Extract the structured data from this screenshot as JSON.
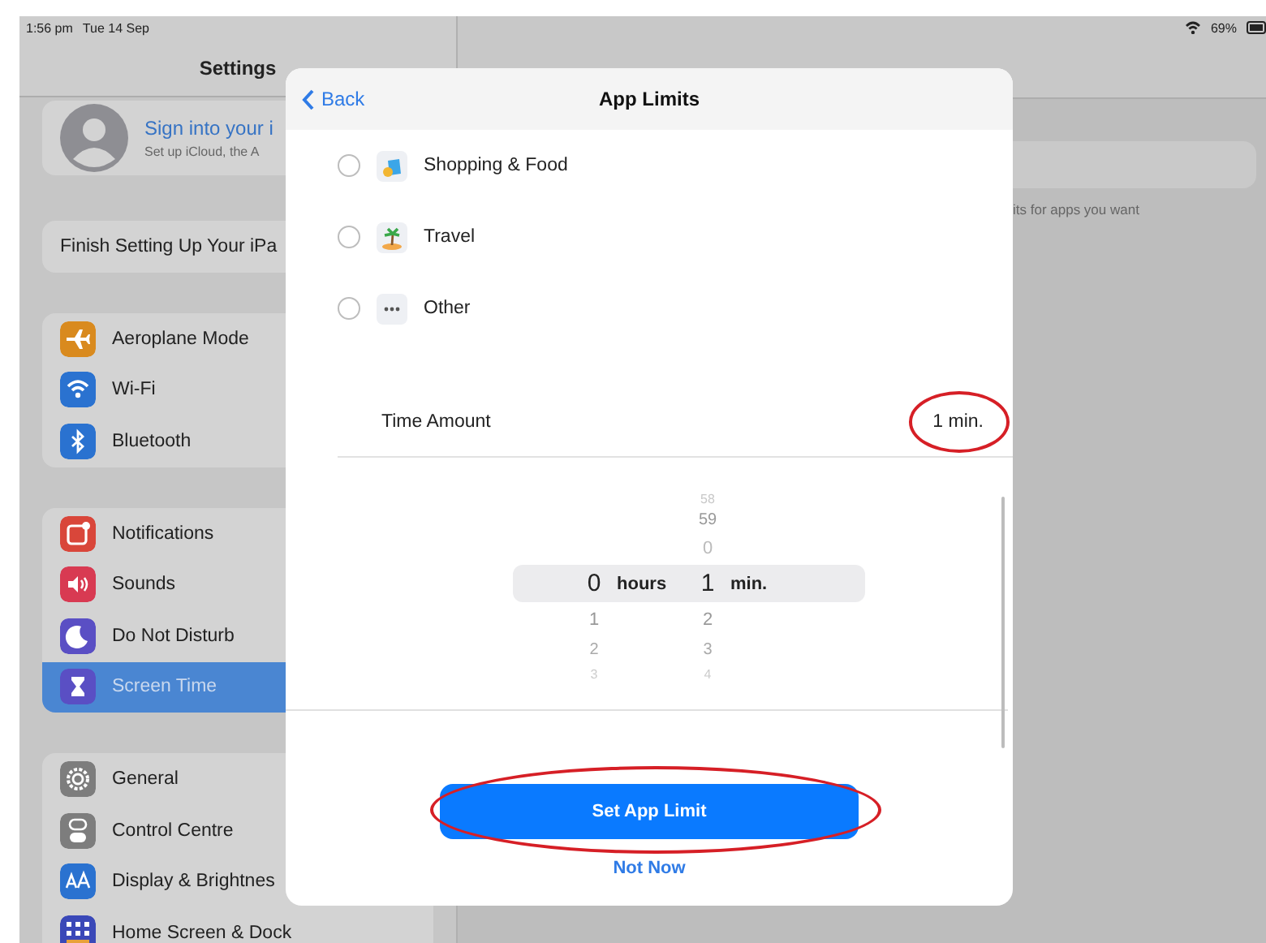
{
  "status_bar": {
    "time": "1:56 pm",
    "date": "Tue 14 Sep",
    "battery": "69%"
  },
  "sidebar": {
    "title": "Settings",
    "account": {
      "title": "Sign into your i",
      "subtitle": "Set up iCloud, the A"
    },
    "setup_card": "Finish Setting Up Your iPa",
    "groups": [
      [
        {
          "label": "Aeroplane Mode",
          "color": "#d98a1e",
          "selected": false
        },
        {
          "label": "Wi-Fi",
          "color": "#2a72d0",
          "selected": false
        },
        {
          "label": "Bluetooth",
          "color": "#2a72d0",
          "selected": false
        }
      ],
      [
        {
          "label": "Notifications",
          "color": "#d9463a",
          "selected": false
        },
        {
          "label": "Sounds",
          "color": "#d83a52",
          "selected": false
        },
        {
          "label": "Do Not Disturb",
          "color": "#5a4fc4",
          "selected": false
        },
        {
          "label": "Screen Time",
          "color": "#5a4fc4",
          "selected": true
        }
      ],
      [
        {
          "label": "General",
          "color": "#7d7d7d",
          "selected": false
        },
        {
          "label": "Control Centre",
          "color": "#7d7d7d",
          "selected": false
        },
        {
          "label": "Display & Brightnes",
          "color": "#2a72d0",
          "selected": false
        },
        {
          "label": "Home Screen & Dock",
          "color": "#3a48b8",
          "selected": false
        }
      ]
    ]
  },
  "detail": {
    "hint": "its for apps you want"
  },
  "sheet": {
    "back": "Back",
    "title": "App Limits",
    "categories": [
      {
        "label": "Shopping & Food",
        "checked": false
      },
      {
        "label": "Travel",
        "checked": false
      },
      {
        "label": "Other",
        "checked": false
      }
    ],
    "time_amount": {
      "label": "Time Amount",
      "value": "1 min.",
      "highlighted": true
    },
    "picker": {
      "columns": [
        {
          "selected": "0",
          "unit": "hours",
          "below": [
            "1",
            "2",
            "3"
          ]
        },
        {
          "above": [
            "58",
            "59",
            "0"
          ],
          "selected": "1",
          "unit": "min.",
          "below": [
            "2",
            "3",
            "4"
          ]
        }
      ]
    },
    "primary_button": {
      "label": "Set App Limit",
      "highlighted": true
    },
    "secondary_button": "Not Now"
  }
}
